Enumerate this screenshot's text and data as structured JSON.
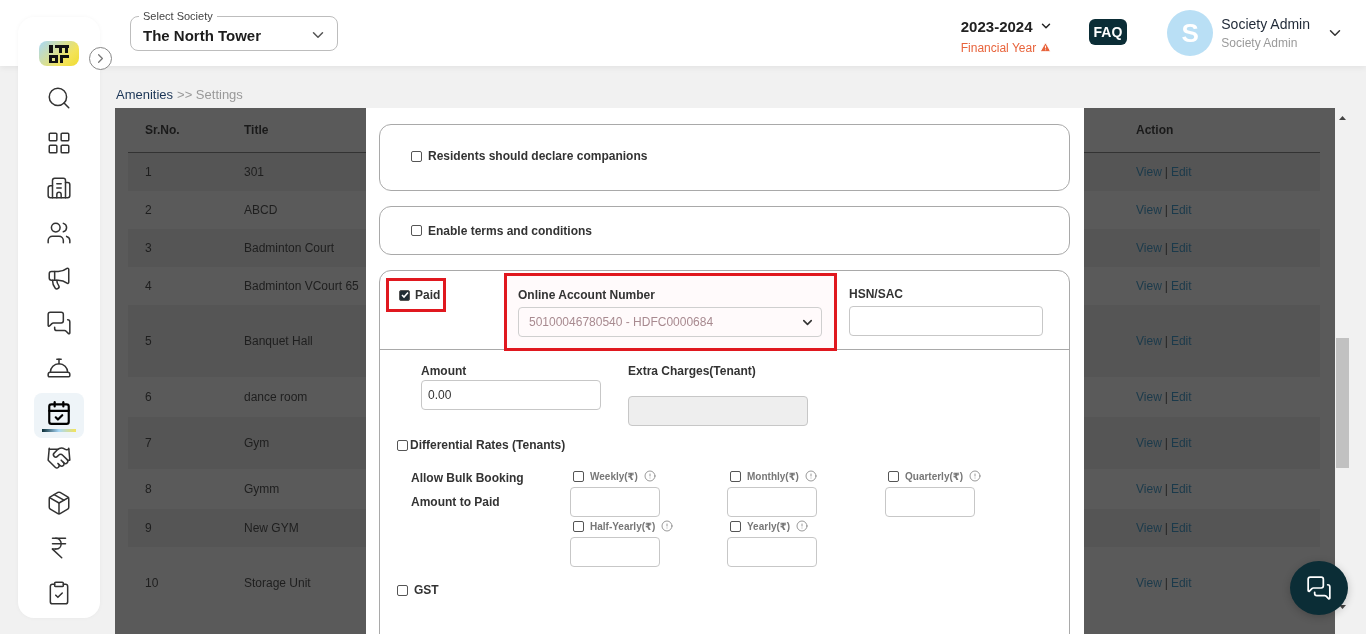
{
  "header": {
    "society_select": {
      "label": "Select Society",
      "value": "The North Tower"
    },
    "financial_year": {
      "value": "2023-2024",
      "label": "Financial Year",
      "warning": true
    },
    "faq": "FAQ",
    "user": {
      "initial": "S",
      "name": "Society Admin",
      "role": "Society Admin"
    }
  },
  "sidebar": {
    "items": [
      {
        "selected": false
      },
      {
        "selected": false
      },
      {
        "selected": false
      },
      {
        "selected": false
      },
      {
        "selected": false
      },
      {
        "selected": false
      },
      {
        "selected": false
      },
      {
        "selected": true
      },
      {
        "selected": false
      },
      {
        "selected": false
      },
      {
        "selected": false
      },
      {
        "selected": false
      }
    ]
  },
  "breadcrumb": {
    "link": "Amenities",
    "separator": ">>",
    "current": "Settings"
  },
  "table": {
    "columns": [
      "Sr.No.",
      "Title",
      "Action"
    ],
    "rows": [
      {
        "sr_no": "1",
        "title": "301",
        "view": "View",
        "separator": "|",
        "edit": "Edit"
      },
      {
        "sr_no": "2",
        "title": "ABCD",
        "view": "View",
        "separator": "|",
        "edit": "Edit"
      },
      {
        "sr_no": "3",
        "title": "Badminton Court",
        "view": "View",
        "separator": "|",
        "edit": "Edit"
      },
      {
        "sr_no": "4",
        "title": "Badminton VCourt 65",
        "view": "View",
        "separator": "|",
        "edit": "Edit"
      },
      {
        "sr_no": "5",
        "title": "Banquet Hall",
        "view": "View",
        "separator": "|",
        "edit": "Edit"
      },
      {
        "sr_no": "6",
        "title": "dance room",
        "view": "View",
        "separator": "|",
        "edit": "Edit"
      },
      {
        "sr_no": "7",
        "title": "Gym",
        "view": "View",
        "separator": "|",
        "edit": "Edit"
      },
      {
        "sr_no": "8",
        "title": "Gymm",
        "view": "View",
        "separator": "|",
        "edit": "Edit"
      },
      {
        "sr_no": "9",
        "title": "New GYM",
        "view": "View",
        "separator": "|",
        "edit": "Edit"
      },
      {
        "sr_no": "10",
        "title": "Storage Unit",
        "view": "View",
        "separator": "|",
        "edit": "Edit"
      }
    ]
  },
  "modal": {
    "options": [
      {
        "label": "Residents should declare companions",
        "checked": false
      },
      {
        "label": "Enable terms and conditions",
        "checked": false
      }
    ],
    "payment": {
      "paid": {
        "label": "Paid",
        "checked": true,
        "highlighted": true
      },
      "online_account": {
        "label": "Online Account Number",
        "value": "50100046780540 - HDFC0000684",
        "highlighted": true
      },
      "hsn_sac": {
        "label": "HSN/SAC"
      },
      "amount": {
        "label": "Amount",
        "value": "0.00"
      },
      "extra_charges": {
        "label": "Extra Charges(Tenant)",
        "disabled": true
      },
      "differential_rates": {
        "label": "Differential Rates (Tenants)",
        "checked": false
      },
      "bulk_booking": {
        "label": "Allow Bulk Booking",
        "amount_label": "Amount to Paid",
        "periods": [
          {
            "label": "Weekly(₹)",
            "checked": false
          },
          {
            "label": "Monthly(₹)",
            "checked": false
          },
          {
            "label": "Quarterly(₹)",
            "checked": false
          },
          {
            "label": "Half-Yearly(₹)",
            "checked": false
          },
          {
            "label": "Yearly(₹)",
            "checked": false
          }
        ]
      },
      "gst": {
        "label": "GST",
        "checked": false
      }
    }
  }
}
